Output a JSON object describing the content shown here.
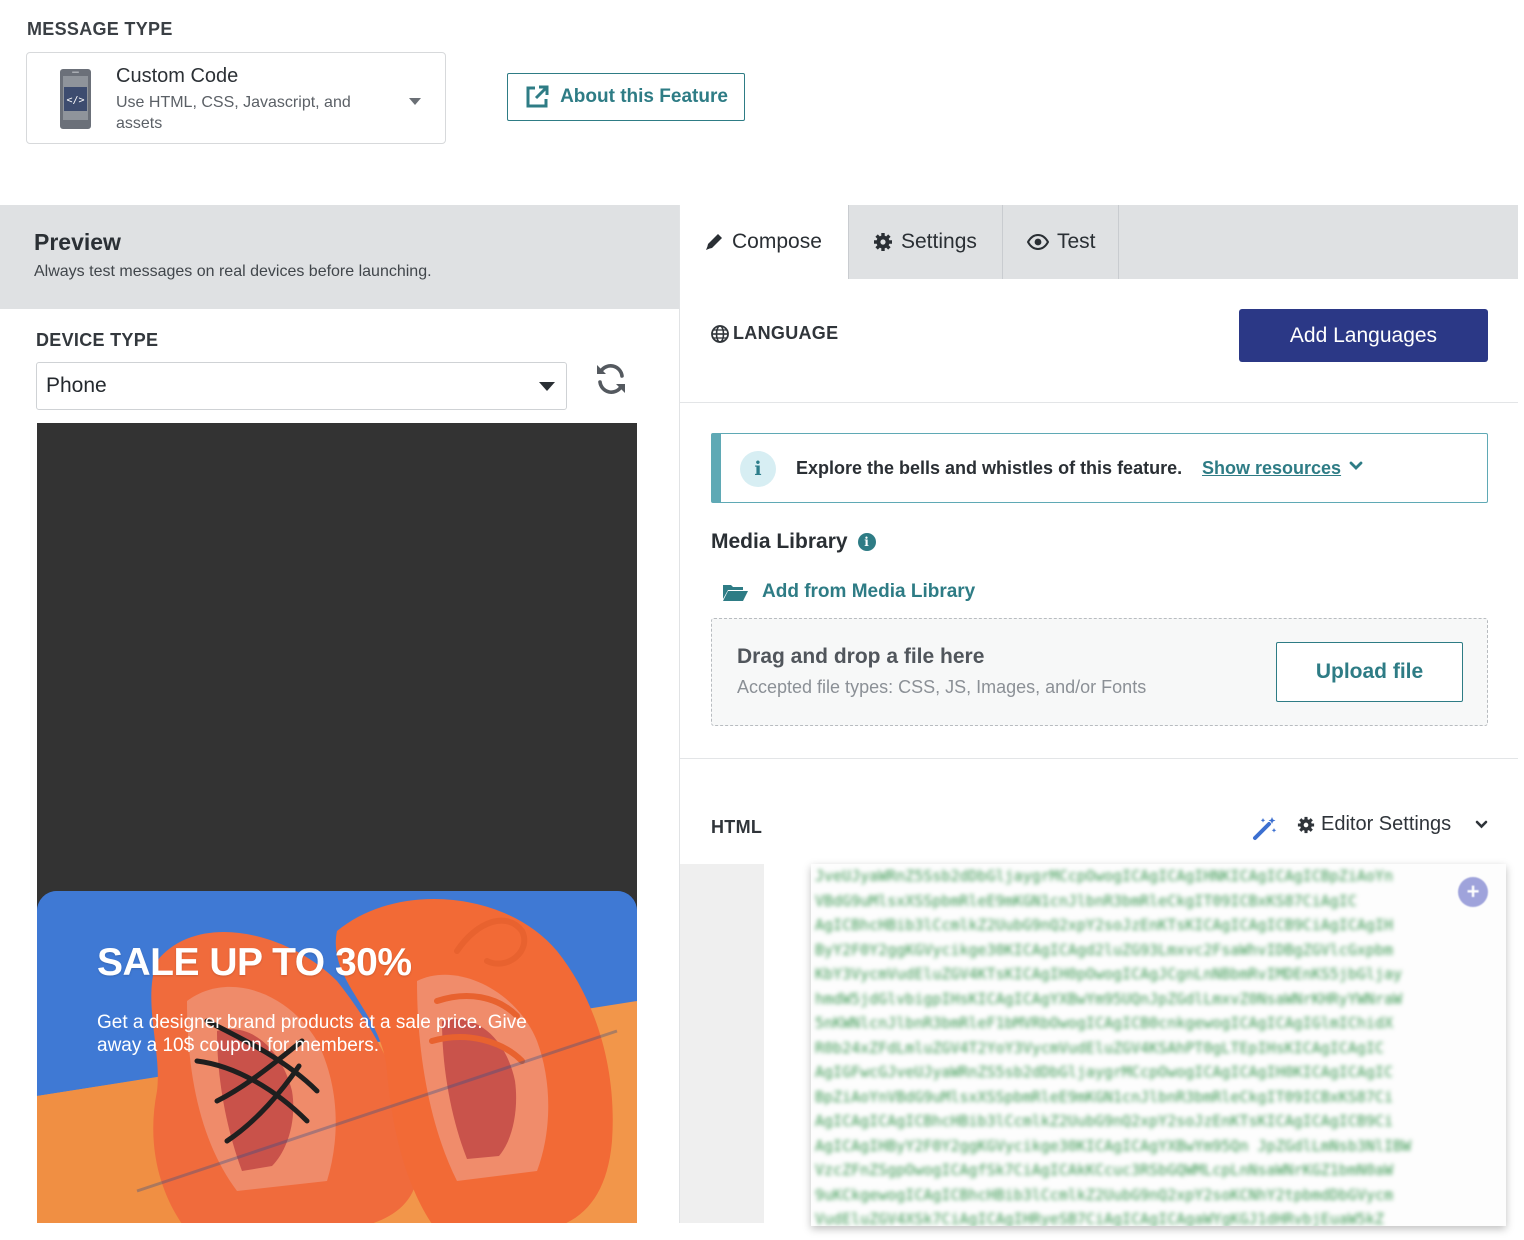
{
  "message_type": {
    "label": "MESSAGE TYPE",
    "selected_title": "Custom Code",
    "selected_description": "Use HTML, CSS, Javascript, and assets",
    "icon": "custom-code-phone-icon"
  },
  "about_button": {
    "label": "About this Feature",
    "icon": "external-link-icon"
  },
  "preview": {
    "title": "Preview",
    "subtitle": "Always test messages on real devices before launching.",
    "device_type_label": "DEVICE TYPE",
    "device_value": "Phone",
    "promo": {
      "title": "SALE UP TO 30%",
      "text": "Get a designer brand products at a sale price. Give away a 10$ coupon for members."
    }
  },
  "tabs": [
    {
      "label": "Compose",
      "icon": "pencil-icon",
      "active": true
    },
    {
      "label": "Settings",
      "icon": "gear-icon",
      "active": false
    },
    {
      "label": "Test",
      "icon": "eye-icon",
      "active": false
    }
  ],
  "language": {
    "label": "LANGUAGE",
    "add_button": "Add Languages"
  },
  "info": {
    "text": "Explore the bells and whistles of this feature.",
    "link": "Show resources"
  },
  "media": {
    "title": "Media Library",
    "add_link": "Add from Media Library",
    "drop_title": "Drag and drop a file here",
    "drop_sub": "Accepted file types: CSS, JS, Images, and/or Fonts",
    "upload_button": "Upload file"
  },
  "editor": {
    "label": "HTML",
    "settings_label": "Editor Settings"
  },
  "colors": {
    "accent_teal": "#2e7c85",
    "primary_navy": "#2b3886",
    "panel_gray": "#dfe1e3",
    "preview_dark": "#333333"
  }
}
